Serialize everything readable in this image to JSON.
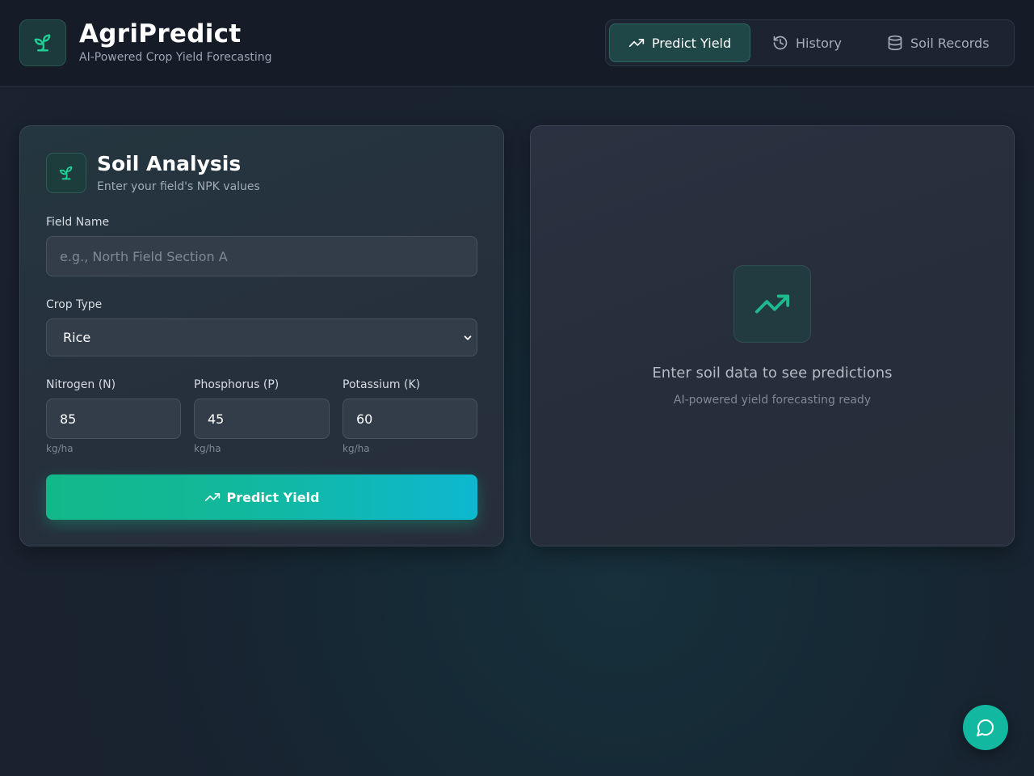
{
  "header": {
    "title": "AgriPredict",
    "subtitle": "AI-Powered Crop Yield Forecasting",
    "logo_icon": "sprout-icon"
  },
  "nav": {
    "items": [
      {
        "label": "Predict Yield",
        "icon": "trending-up-icon",
        "active": true
      },
      {
        "label": "History",
        "icon": "history-icon",
        "active": false
      },
      {
        "label": "Soil Records",
        "icon": "database-icon",
        "active": false
      }
    ]
  },
  "form": {
    "title": "Soil Analysis",
    "subtitle": "Enter your field's NPK values",
    "field_name": {
      "label": "Field Name",
      "placeholder": "e.g., North Field Section A",
      "value": ""
    },
    "crop_type": {
      "label": "Crop Type",
      "selected": "Rice"
    },
    "nitrogen": {
      "label": "Nitrogen (N)",
      "value": "85",
      "unit": "kg/ha"
    },
    "phosphorus": {
      "label": "Phosphorus (P)",
      "value": "45",
      "unit": "kg/ha"
    },
    "potassium": {
      "label": "Potassium (K)",
      "value": "60",
      "unit": "kg/ha"
    },
    "submit_label": "Predict Yield"
  },
  "results": {
    "empty_title": "Enter soil data to see predictions",
    "empty_subtitle": "AI-powered yield forecasting ready"
  },
  "colors": {
    "accent": "#13b889",
    "accent_cyan": "#0db8d0",
    "background": "#1b2230"
  }
}
